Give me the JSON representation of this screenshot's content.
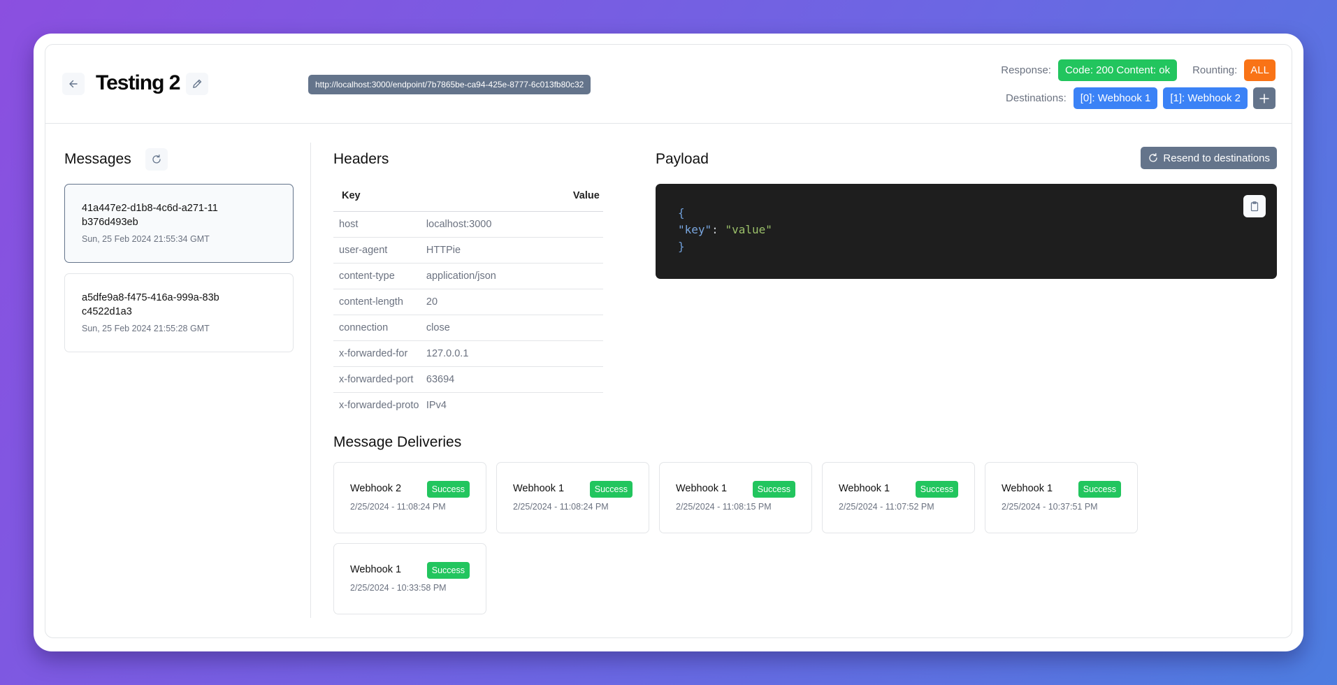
{
  "header": {
    "title": "Testing 2",
    "endpoint_url": "http://localhost:3000/endpoint/7b7865be-ca94-425e-8777-6c013fb80c32",
    "response_label": "Response:",
    "response_value": "Code: 200 Content: ok",
    "routing_label": "Rounting:",
    "routing_value": "ALL",
    "destinations_label": "Destinations:",
    "destinations": [
      {
        "label": "[0]: Webhook 1"
      },
      {
        "label": "[1]: Webhook 2"
      }
    ],
    "add_destination_icon": "plus-icon",
    "back_icon": "arrow-left-icon",
    "edit_icon": "pencil-icon"
  },
  "messages": {
    "title": "Messages",
    "refresh_icon": "refresh-icon",
    "items": [
      {
        "id": "41a447e2-d1b8-4c6d-a271-11b376d493eb",
        "time": "Sun, 25 Feb 2024 21:55:34 GMT",
        "selected": true
      },
      {
        "id": "a5dfe9a8-f475-416a-999a-83bc4522d1a3",
        "time": "Sun, 25 Feb 2024 21:55:28 GMT",
        "selected": false
      }
    ]
  },
  "headers": {
    "title": "Headers",
    "columns": [
      "Key",
      "Value"
    ],
    "rows": [
      {
        "key": "host",
        "value": "localhost:3000"
      },
      {
        "key": "user-agent",
        "value": "HTTPie"
      },
      {
        "key": "content-type",
        "value": "application/json"
      },
      {
        "key": "content-length",
        "value": "20"
      },
      {
        "key": "connection",
        "value": "close"
      },
      {
        "key": "x-forwarded-for",
        "value": "127.0.0.1"
      },
      {
        "key": "x-forwarded-port",
        "value": "63694"
      },
      {
        "key": "x-forwarded-proto",
        "value": "IPv4"
      }
    ]
  },
  "payload": {
    "title": "Payload",
    "resend_label": "Resend to destinations",
    "code": {
      "open": "{",
      "key": "\"key\"",
      "colon": ": ",
      "value": "\"value\"",
      "close": "}"
    },
    "copy_icon": "clipboard-icon"
  },
  "deliveries": {
    "title": "Message Deliveries",
    "items": [
      {
        "name": "Webhook 2",
        "status": "Success",
        "time": "2/25/2024 - 11:08:24 PM"
      },
      {
        "name": "Webhook 1",
        "status": "Success",
        "time": "2/25/2024 - 11:08:24 PM"
      },
      {
        "name": "Webhook 1",
        "status": "Success",
        "time": "2/25/2024 - 11:08:15 PM"
      },
      {
        "name": "Webhook 1",
        "status": "Success",
        "time": "2/25/2024 - 11:07:52 PM"
      },
      {
        "name": "Webhook 1",
        "status": "Success",
        "time": "2/25/2024 - 10:37:51 PM"
      },
      {
        "name": "Webhook 1",
        "status": "Success",
        "time": "2/25/2024 - 10:33:58 PM"
      }
    ]
  },
  "colors": {
    "success": "#22c55e",
    "routing": "#f97316",
    "destination": "#3b82f6",
    "neutral": "#64748b",
    "code_bg": "#1e1e1e"
  }
}
